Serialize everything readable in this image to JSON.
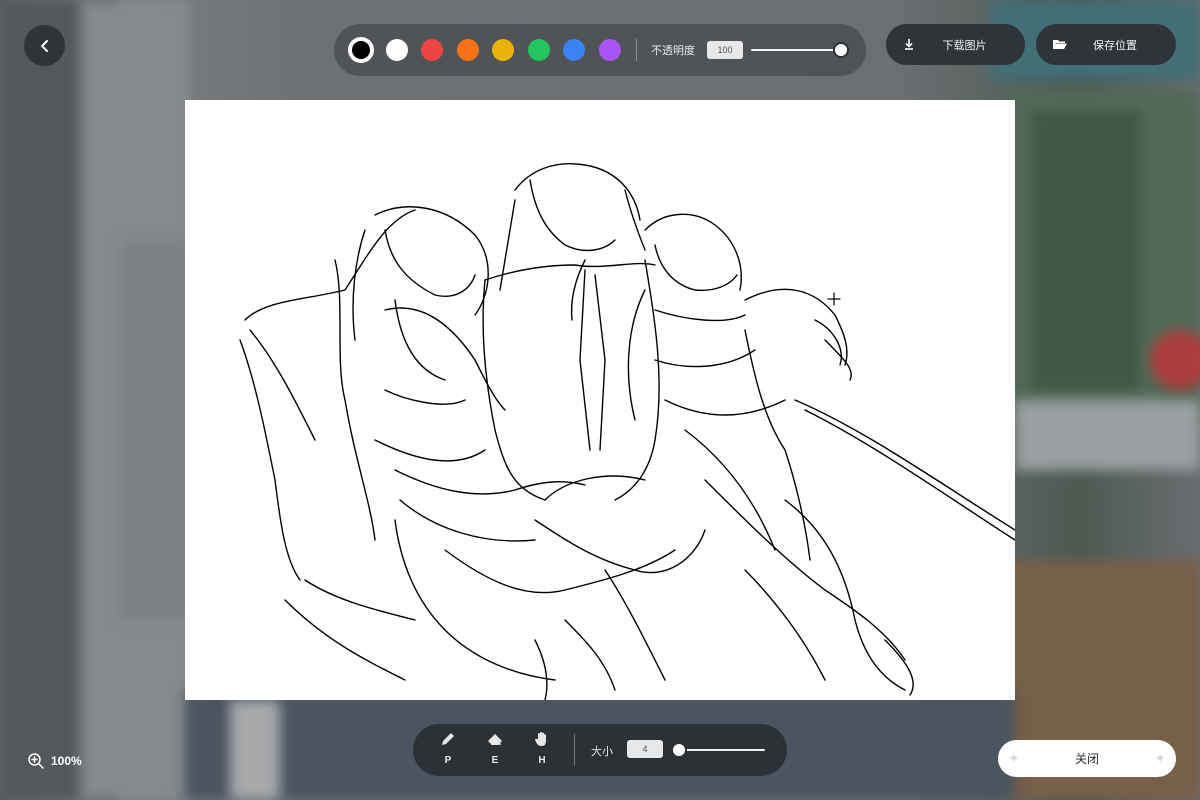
{
  "navigation": {
    "back_icon": "chevron-left-icon"
  },
  "top_toolbar": {
    "colors": [
      {
        "name": "black",
        "hex": "#000000",
        "selected": true
      },
      {
        "name": "white",
        "hex": "#ffffff",
        "selected": false
      },
      {
        "name": "red",
        "hex": "#ef4444",
        "selected": false
      },
      {
        "name": "orange",
        "hex": "#f97316",
        "selected": false
      },
      {
        "name": "yellow",
        "hex": "#eab308",
        "selected": false
      },
      {
        "name": "green",
        "hex": "#22c55e",
        "selected": false
      },
      {
        "name": "blue",
        "hex": "#3b82f6",
        "selected": false
      },
      {
        "name": "purple",
        "hex": "#a855f7",
        "selected": false
      }
    ],
    "opacity_label": "不透明度",
    "opacity_value": "100",
    "opacity_level": 1.0
  },
  "actions": {
    "download_label": "下载图片",
    "download_icon": "download-icon",
    "save_location_label": "保存位置",
    "save_location_icon": "folder-open-icon"
  },
  "bottom_toolbar": {
    "tools": [
      {
        "name": "pen",
        "key": "P",
        "icon": "pen-icon"
      },
      {
        "name": "eraser",
        "key": "E",
        "icon": "eraser-icon"
      },
      {
        "name": "hand",
        "key": "H",
        "icon": "hand-icon"
      }
    ],
    "size_label": "大小",
    "size_value": "4",
    "size_level": 0.0
  },
  "zoom": {
    "icon": "zoom-in-icon",
    "label": "100%"
  },
  "close_button": {
    "label": "关闭"
  },
  "theme": {
    "panel": "#2f3438",
    "accent": "#ffffff"
  }
}
